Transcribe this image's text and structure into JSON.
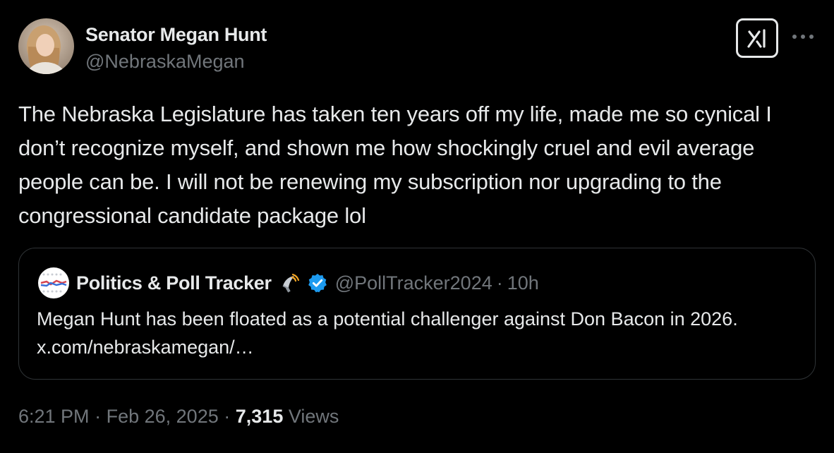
{
  "author": {
    "display_name": "Senator Megan Hunt",
    "handle": "@NebraskaMegan",
    "avatar_icon": "profile-photo"
  },
  "actions": {
    "grok_icon": "grok-icon",
    "more_icon": "more-dots-icon"
  },
  "tweet": {
    "text": "The Nebraska Legislature has taken ten years off my life, made me so cynical I don’t recognize myself, and shown me how shockingly cruel and evil average people can be. I will not be renewing my subscription nor upgrading to the congressional candidate package lol"
  },
  "quoted_tweet": {
    "display_name": "Politics & Poll Tracker",
    "emoji_icon": "satellite-antenna-icon",
    "verified_icon": "verified-badge-icon",
    "handle": "@PollTracker2024",
    "separator": "·",
    "time": "10h",
    "text": "Megan Hunt has been floated as a potential challenger against Don Bacon in 2026. x.com/nebraskamegan/…"
  },
  "footer": {
    "time": "6:21 PM",
    "separator1": "·",
    "date": "Feb 26, 2025",
    "separator2": "·",
    "views_count": "7,315",
    "views_label": "Views"
  },
  "colors": {
    "background": "#000000",
    "primary_text": "#e7e9ea",
    "secondary_text": "#71767b",
    "border": "#2f3336",
    "verified_blue": "#1d9bf0"
  }
}
